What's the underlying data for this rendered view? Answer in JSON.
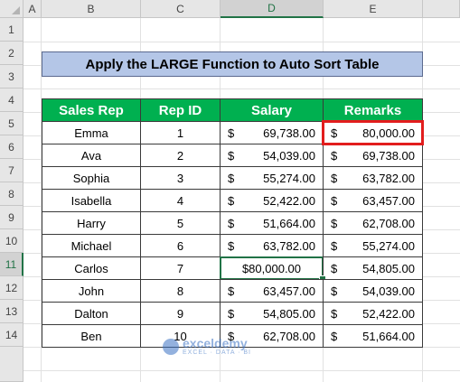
{
  "columns": [
    "A",
    "B",
    "C",
    "D",
    "E"
  ],
  "rows": [
    "1",
    "2",
    "3",
    "4",
    "5",
    "6",
    "7",
    "8",
    "9",
    "10",
    "11",
    "12",
    "13",
    "14"
  ],
  "selected_column": "D",
  "selected_row": "11",
  "title": "Apply the LARGE Function to Auto Sort Table",
  "headers": {
    "rep": "Sales Rep",
    "id": "Rep ID",
    "salary": "Salary",
    "remarks": "Remarks"
  },
  "currency_symbol": "$",
  "table": [
    {
      "rep": "Emma",
      "id": "1",
      "salary": "69,738.00",
      "remarks": "80,000.00"
    },
    {
      "rep": "Ava",
      "id": "2",
      "salary": "54,039.00",
      "remarks": "69,738.00"
    },
    {
      "rep": "Sophia",
      "id": "3",
      "salary": "55,274.00",
      "remarks": "63,782.00"
    },
    {
      "rep": "Isabella",
      "id": "4",
      "salary": "52,422.00",
      "remarks": "63,457.00"
    },
    {
      "rep": "Harry",
      "id": "5",
      "salary": "51,664.00",
      "remarks": "62,708.00"
    },
    {
      "rep": "Michael",
      "id": "6",
      "salary": "63,782.00",
      "remarks": "55,274.00"
    },
    {
      "rep": "Carlos",
      "id": "7",
      "salary": "$80,000.00",
      "remarks": "54,805.00"
    },
    {
      "rep": "John",
      "id": "8",
      "salary": "63,457.00",
      "remarks": "54,039.00"
    },
    {
      "rep": "Dalton",
      "id": "9",
      "salary": "54,805.00",
      "remarks": "52,422.00"
    },
    {
      "rep": "Ben",
      "id": "10",
      "salary": "62,708.00",
      "remarks": "51,664.00"
    }
  ],
  "watermark": {
    "name": "exceldemy",
    "tag": "EXCEL · DATA · BI"
  },
  "colors": {
    "header_green": "#00b050",
    "title_blue": "#b4c6e7",
    "selection_green": "#217346",
    "highlight_red": "#e21d1d"
  }
}
